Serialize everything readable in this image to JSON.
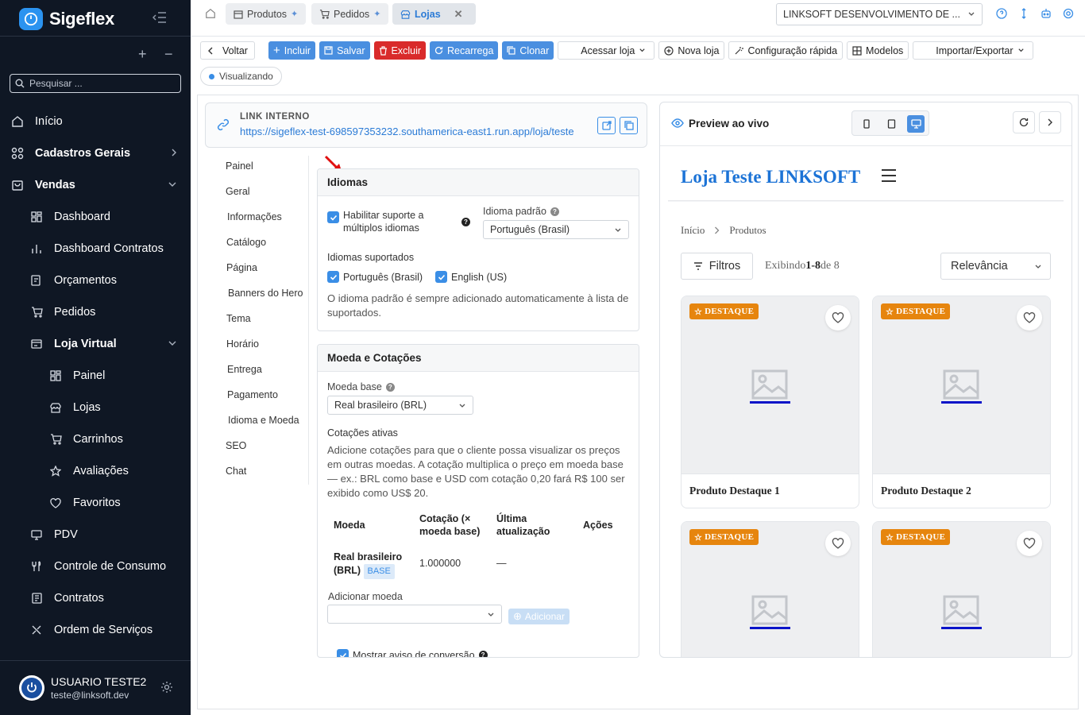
{
  "app": {
    "name": "Sigeflex"
  },
  "sidebar": {
    "search_placeholder": "Pesquisar ...",
    "items": [
      {
        "label": "Início",
        "icon": "home-icon"
      },
      {
        "label": "Cadastros Gerais",
        "icon": "grid-icon"
      },
      {
        "label": "Vendas",
        "icon": "bag-icon"
      },
      {
        "label": "Dashboard",
        "icon": "dashboard-icon"
      },
      {
        "label": "Dashboard Contratos",
        "icon": "bar-chart-icon"
      },
      {
        "label": "Orçamentos",
        "icon": "edit-doc-icon"
      },
      {
        "label": "Pedidos",
        "icon": "cart-icon"
      },
      {
        "label": "Loja Virtual",
        "icon": "store-card-icon"
      },
      {
        "label": "Painel",
        "icon": "dashboard-icon"
      },
      {
        "label": "Lojas",
        "icon": "store-icon"
      },
      {
        "label": "Carrinhos",
        "icon": "cart-icon"
      },
      {
        "label": "Avaliações",
        "icon": "star-icon"
      },
      {
        "label": "Favoritos",
        "icon": "heart-icon"
      },
      {
        "label": "PDV",
        "icon": "monitor-icon"
      },
      {
        "label": "Controle de Consumo",
        "icon": "utensils-icon"
      },
      {
        "label": "Contratos",
        "icon": "document-icon"
      },
      {
        "label": "Ordem de Serviços",
        "icon": "tools-icon"
      }
    ],
    "user": {
      "name": "USUARIO TESTE2",
      "email": "teste@linksoft.dev"
    }
  },
  "tabs": [
    {
      "label": "Produtos",
      "pinned": true
    },
    {
      "label": "Pedidos",
      "pinned": true
    },
    {
      "label": "Lojas",
      "active": true
    }
  ],
  "company_select": "LINKSOFT DESENVOLVIMENTO DE ...",
  "toolbar": {
    "voltar": "Voltar",
    "incluir": "Incluir",
    "salvar": "Salvar",
    "excluir": "Excluir",
    "recarrega": "Recarrega",
    "clonar": "Clonar",
    "acessar_loja": "Acessar loja",
    "nova_loja": "Nova loja",
    "config_rapida": "Configuração rápida",
    "modelos": "Modelos",
    "importar": "Importar/Exportar"
  },
  "status": "Visualizando",
  "link": {
    "label": "LINK INTERNO",
    "url": "https://sigeflex-test-698597353232.southamerica-east1.run.app/loja/teste"
  },
  "subnav": [
    "Painel",
    "Geral",
    "Informações",
    "Catálogo",
    "Página",
    "Banners do Hero",
    "Tema",
    "Horário",
    "Entrega",
    "Pagamento",
    "Idioma e Moeda",
    "SEO",
    "Chat"
  ],
  "subnav_active": "Idioma e Moeda",
  "idiomas": {
    "title": "Idiomas",
    "habilitar_label": "Habilitar suporte a múltiplos idiomas",
    "habilitar_line1": "Habilitar suporte a",
    "habilitar_line2": "múltiplos idiomas",
    "idioma_padrao_label": "Idioma padrão",
    "idioma_padrao_value": "Português (Brasil)",
    "suportados_label": "Idiomas suportados",
    "suportados": [
      "Português (Brasil)",
      "English (US)"
    ],
    "hint": "O idioma padrão é sempre adicionado automaticamente à lista de suportados."
  },
  "moeda": {
    "title": "Moeda e Cotações",
    "moeda_base_label": "Moeda base",
    "moeda_base_value": "Real brasileiro (BRL)",
    "cotacoes_label": "Cotações ativas",
    "description": "Adicione cotações para que o cliente possa visualizar os preços em outras moedas. A cotação multiplica o preço em moeda base — ex.: BRL como base e USD com cotação 0,20 fará R$ 100 ser exibido como US$ 20.",
    "table": {
      "headers": [
        "Moeda",
        "Cotação (× moeda base)",
        "Última atualização",
        "Ações"
      ],
      "rows": [
        {
          "moeda": "Real brasileiro (BRL)",
          "badge": "BASE",
          "cotacao": "1.000000",
          "atualizacao": "—"
        }
      ]
    },
    "adicionar_label": "Adicionar moeda",
    "adicionar_button": "Adicionar",
    "aviso_label": "Mostrar aviso de conversão"
  },
  "preview": {
    "title": "Preview ao vivo",
    "store_name": "Loja Teste LINKSOFT",
    "breadcrumb": [
      "Início",
      "Produtos"
    ],
    "filtros": "Filtros",
    "exibindo_prefix": "Exibindo",
    "exibindo_range": "1-8",
    "exibindo_suffix": "de 8",
    "sort": "Relevância",
    "badge": "DESTAQUE",
    "products": [
      "Produto Destaque 1",
      "Produto Destaque 2",
      "",
      ""
    ]
  },
  "colors": {
    "accent": "#3a8ee6",
    "sidebar_bg": "#0f1724",
    "danger": "#d92b2b",
    "badge_orange": "#e6850e"
  }
}
